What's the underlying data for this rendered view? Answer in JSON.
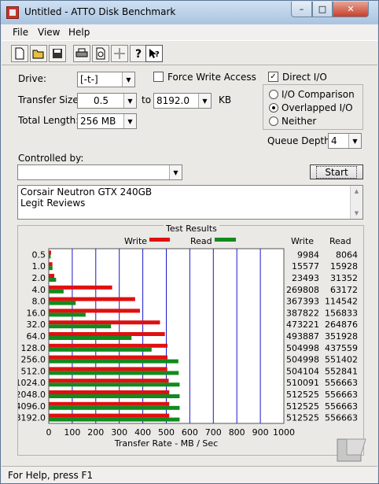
{
  "window": {
    "title": "Untitled - ATTO Disk Benchmark"
  },
  "titlebar": {
    "min": "–",
    "max": "□",
    "close": "✕"
  },
  "menu": [
    "File",
    "View",
    "Help"
  ],
  "toolbar": [
    "new-icon",
    "open-icon",
    "save-icon",
    "print-icon",
    "print-preview-icon",
    "move-icon",
    "help-icon",
    "context-help-icon"
  ],
  "form": {
    "drive_label": "Drive:",
    "drive_value": "[-t-]",
    "force_write_label": "Force Write Access",
    "direct_io_label": "Direct I/O",
    "transfer_size_label": "Transfer Size:",
    "transfer_from": "0.5",
    "to_label": "to",
    "transfer_to": "8192.0",
    "kb_label": "KB",
    "total_length_label": "Total Length:",
    "total_length_value": "256 MB",
    "io_comparison_label": "I/O Comparison",
    "overlapped_io_label": "Overlapped I/O",
    "neither_label": "Neither",
    "queue_depth_label": "Queue Depth:",
    "queue_depth_value": "4",
    "controlled_by_label": "Controlled by:",
    "controlled_by_value": "",
    "start_label": "Start",
    "notes_line1": "Corsair Neutron GTX 240GB",
    "notes_line2": "Legit Reviews"
  },
  "state": {
    "force_write": false,
    "direct_io": true,
    "io_mode": "Overlapped I/O"
  },
  "results": {
    "caption": "Test Results",
    "write_header": "Write",
    "read_header": "Read"
  },
  "status": {
    "text": "For Help, press F1"
  },
  "colors": {
    "write": "#e01010",
    "read": "#118a1e",
    "grid": "#1818c8"
  },
  "chart_data": {
    "type": "bar",
    "orientation": "horizontal",
    "title": "Test Results",
    "xlabel": "Transfer Rate - MB / Sec",
    "xlim": [
      0,
      1000
    ],
    "xticks": [
      0,
      100,
      200,
      300,
      400,
      500,
      600,
      700,
      800,
      900,
      1000
    ],
    "categories": [
      "0.5",
      "1.0",
      "2.0",
      "4.0",
      "8.0",
      "16.0",
      "32.0",
      "64.0",
      "128.0",
      "256.0",
      "512.0",
      "1024.0",
      "2048.0",
      "4096.0",
      "8192.0"
    ],
    "series": [
      {
        "name": "Write",
        "values": [
          9984,
          15577,
          23493,
          269808,
          367393,
          387822,
          473221,
          493887,
          504998,
          504998,
          504104,
          510091,
          512525,
          512525,
          512525
        ]
      },
      {
        "name": "Read",
        "values": [
          8064,
          15928,
          31352,
          63172,
          114542,
          156833,
          264876,
          351928,
          437559,
          551402,
          552841,
          556663,
          556663,
          556663,
          556663
        ]
      }
    ]
  }
}
